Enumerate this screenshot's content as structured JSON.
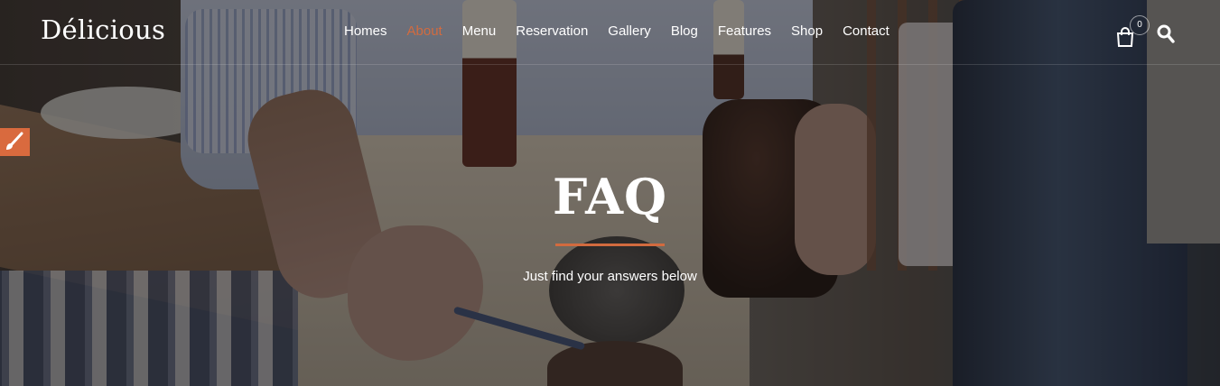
{
  "brand": {
    "logo_text": "Délicious"
  },
  "nav": {
    "items": [
      {
        "label": "Homes",
        "active": false
      },
      {
        "label": "About",
        "active": true
      },
      {
        "label": "Menu",
        "active": false
      },
      {
        "label": "Reservation",
        "active": false
      },
      {
        "label": "Gallery",
        "active": false
      },
      {
        "label": "Blog",
        "active": false
      },
      {
        "label": "Features",
        "active": false
      },
      {
        "label": "Shop",
        "active": false
      },
      {
        "label": "Contact",
        "active": false
      }
    ]
  },
  "cart": {
    "icon": "shopping-bag-icon",
    "count": "0"
  },
  "search": {
    "icon": "search-icon"
  },
  "side_tool": {
    "icon": "paint-brush-icon"
  },
  "hero": {
    "title": "FAQ",
    "subtitle": "Just find your answers below"
  },
  "colors": {
    "accent": "#d26b3f",
    "text": "#ffffff"
  }
}
